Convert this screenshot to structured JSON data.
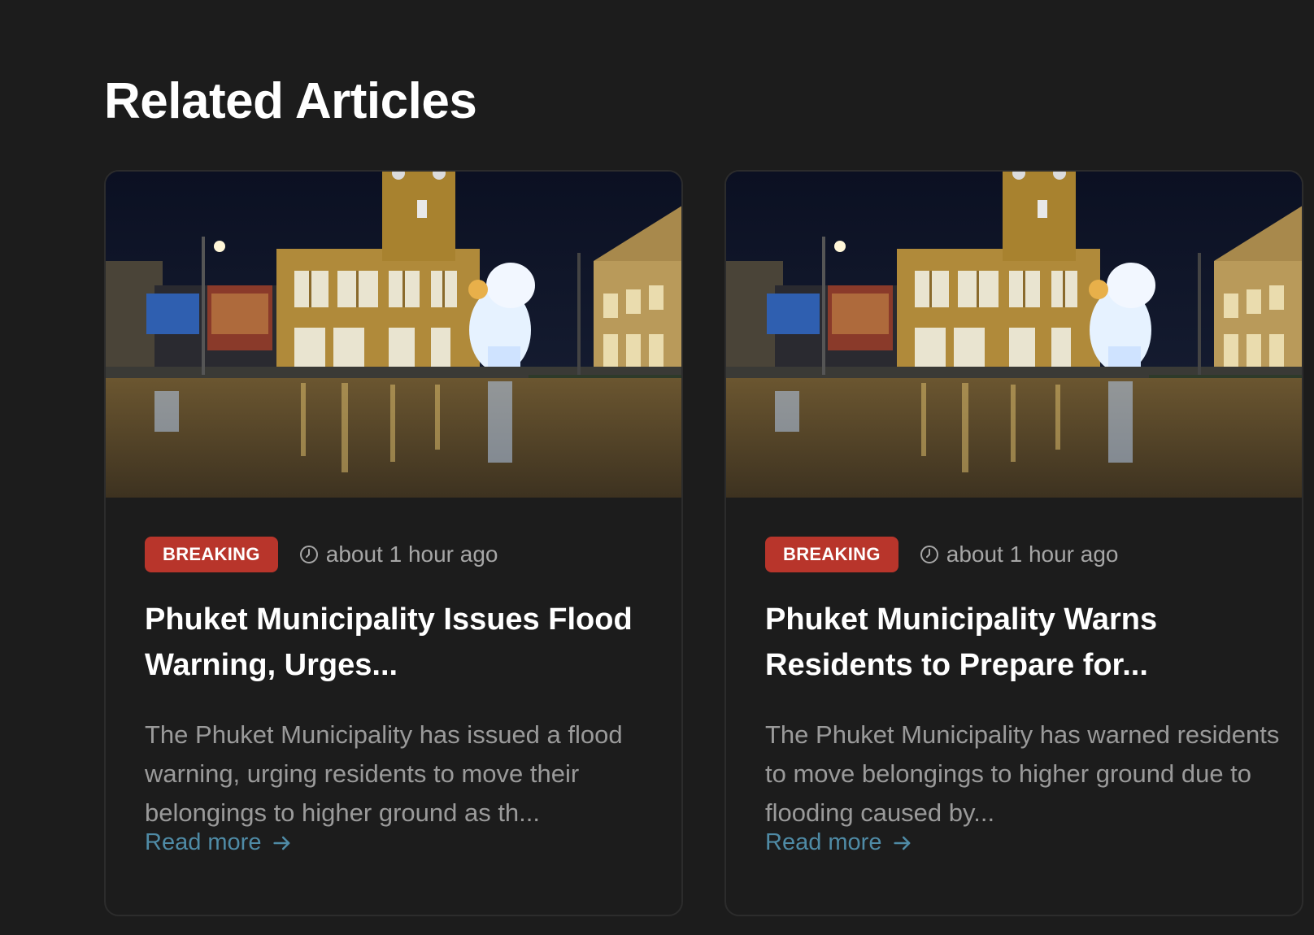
{
  "section": {
    "title": "Related Articles"
  },
  "articles": [
    {
      "badge": "BREAKING",
      "time": "about 1 hour ago",
      "title": "Phuket Municipality Issues Flood Warning, Urges...",
      "excerpt": "The Phuket Municipality has issued a flood warning, urging residents to move their belongings to higher ground as th...",
      "read_more": "Read more"
    },
    {
      "badge": "BREAKING",
      "time": "about 1 hour ago",
      "title": "Phuket Municipality Warns Residents to Prepare for...",
      "excerpt": "The Phuket Municipality has warned residents to move belongings to higher ground due to flooding caused by...",
      "read_more": "Read more"
    }
  ],
  "colors": {
    "background": "#1c1c1c",
    "badge": "#b8352b",
    "link": "#4f8ba6",
    "muted_text": "#9a9a9a"
  },
  "icons": {
    "clock": "clock-icon",
    "arrow": "arrow-right-icon"
  }
}
